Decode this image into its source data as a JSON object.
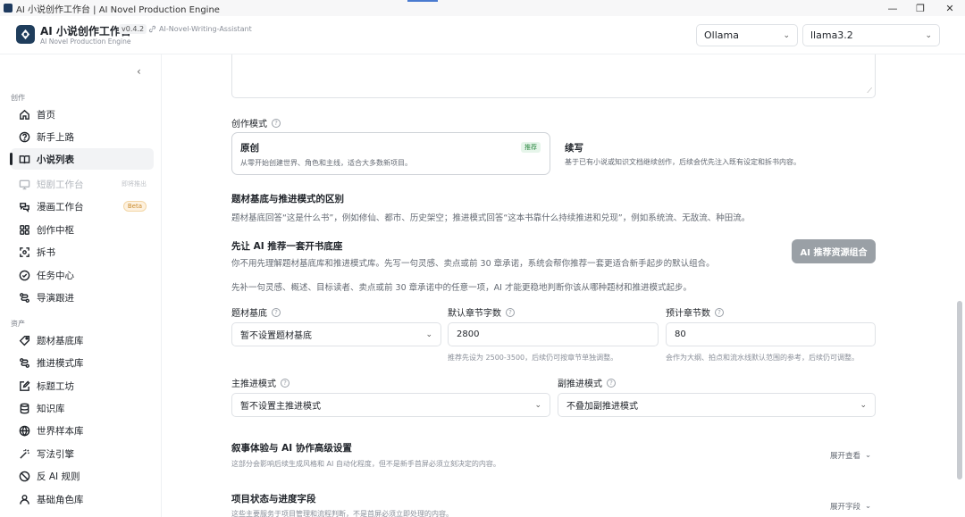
{
  "window": {
    "title": "AI 小说创作工作台 | AI Novel Production Engine",
    "minimize": "—",
    "maximize": "❐",
    "close": "✕"
  },
  "header": {
    "brand_title": "AI 小说创作工作台",
    "brand_subtitle": "AI Novel Production Engine",
    "version": "v0.4.2",
    "repo": "AI-Novel-Writing-Assistant",
    "provider_select": "Ollama",
    "model_select": "llama3.2"
  },
  "sidebar": {
    "collapse_icon": "‹",
    "groups": [
      {
        "label": "创作",
        "items": [
          {
            "label": "首页",
            "icon": "home-icon"
          },
          {
            "label": "新手上路",
            "icon": "help-circle-icon"
          },
          {
            "label": "小说列表",
            "icon": "book-open-icon",
            "active": true
          },
          {
            "label": "短剧工作台",
            "icon": "monitor-icon",
            "disabled": true,
            "tag": "即将推出"
          },
          {
            "label": "漫画工作台",
            "icon": "comic-icon",
            "badge": "Beta"
          },
          {
            "label": "创作中枢",
            "icon": "grid-icon"
          },
          {
            "label": "拆书",
            "icon": "scan-icon"
          },
          {
            "label": "任务中心",
            "icon": "task-icon"
          },
          {
            "label": "导演跟进",
            "icon": "flow-icon"
          }
        ]
      },
      {
        "label": "资产",
        "items": [
          {
            "label": "题材基底库",
            "icon": "tag-icon"
          },
          {
            "label": "推进模式库",
            "icon": "flow-icon"
          },
          {
            "label": "标题工坊",
            "icon": "edit-icon"
          },
          {
            "label": "知识库",
            "icon": "database-icon"
          },
          {
            "label": "世界样本库",
            "icon": "globe-icon"
          },
          {
            "label": "写法引擎",
            "icon": "wand-icon"
          },
          {
            "label": "反 AI 规则",
            "icon": "ban-icon"
          },
          {
            "label": "基础角色库",
            "icon": "user-icon"
          }
        ]
      }
    ]
  },
  "form": {
    "mode_label": "创作模式",
    "modes": [
      {
        "title": "原创",
        "desc": "从零开始创建世界、角色和主线，适合大多数新项目。",
        "badge": "推荐"
      },
      {
        "title": "续写",
        "desc": "基于已有小说或知识文档继续创作，后续会优先注入既有设定和拆书内容。"
      }
    ],
    "diff_title": "题材基底与推进模式的区别",
    "diff_desc": "题材基底回答“这是什么书”，例如修仙、都市、历史架空；推进模式回答“这本书靠什么持续推进和兑现”，例如系统流、无敌流、种田流。",
    "rec_title": "先让 AI 推荐一套开书底座",
    "rec_desc1": "你不用先理解题材基底库和推进模式库。先写一句灵感、卖点或前 30 章承诺，系统会帮你推荐一套更适合新手起步的默认组合。",
    "rec_desc2": "先补一句灵感、概述、目标读者、卖点或前 30 章承诺中的任意一项，AI 才能更稳地判断你该从哪种题材和推进模式起步。",
    "rec_button": "AI 推荐资源组合",
    "genre_label": "题材基底",
    "genre_value": "暂不设置题材基底",
    "words_label": "默认章节字数",
    "words_value": "2800",
    "words_hint": "推荐先设为 2500-3500，后续仍可按章节单独调整。",
    "chapters_label": "预计章节数",
    "chapters_value": "80",
    "chapters_hint": "会作为大纲、拍点和流水线默认范围的参考，后续仍可调整。",
    "main_drive_label": "主推进模式",
    "main_drive_value": "暂不设置主推进模式",
    "sub_drive_label": "副推进模式",
    "sub_drive_value": "不叠加副推进模式",
    "adv_title": "叙事体验与 AI 协作高级设置",
    "adv_desc": "这部分会影响后续生成风格和 AI 自动化程度，但不是新手首屏必须立刻决定的内容。",
    "adv_toggle": "展开查看",
    "status_title": "项目状态与进度字段",
    "status_desc": "这些主要服务于项目管理和流程判断，不是首屏必须立即处理的内容。",
    "status_toggle": "展开字段"
  }
}
